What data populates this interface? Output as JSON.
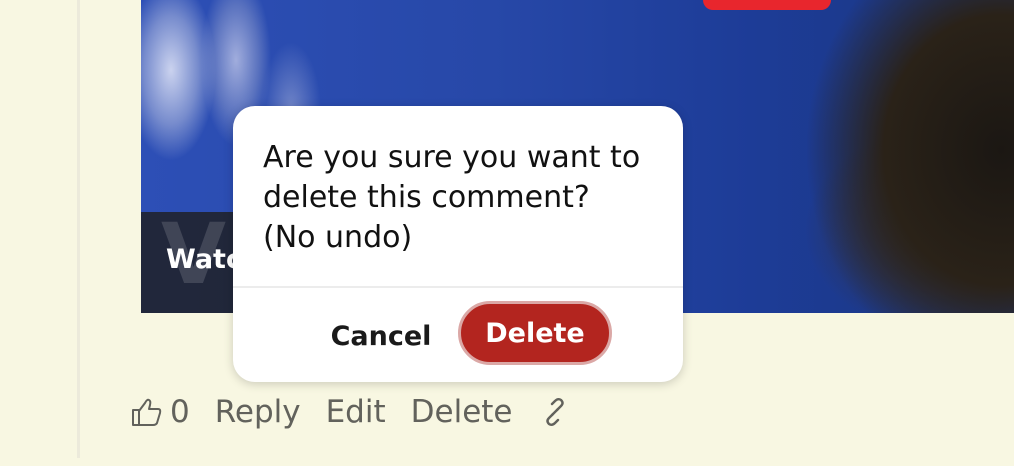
{
  "video": {
    "watch_label": "Watc",
    "watermark": "V"
  },
  "dialog": {
    "message": "Are you sure you want to\ndelete this comment?\n(No undo)",
    "cancel_label": "Cancel",
    "delete_label": "Delete",
    "delete_color": "#b3251f"
  },
  "comment_actions": {
    "like_icon": "thumbs-up-icon",
    "like_count": "0",
    "reply_label": "Reply",
    "edit_label": "Edit",
    "delete_label": "Delete",
    "link_icon": "link-icon"
  }
}
